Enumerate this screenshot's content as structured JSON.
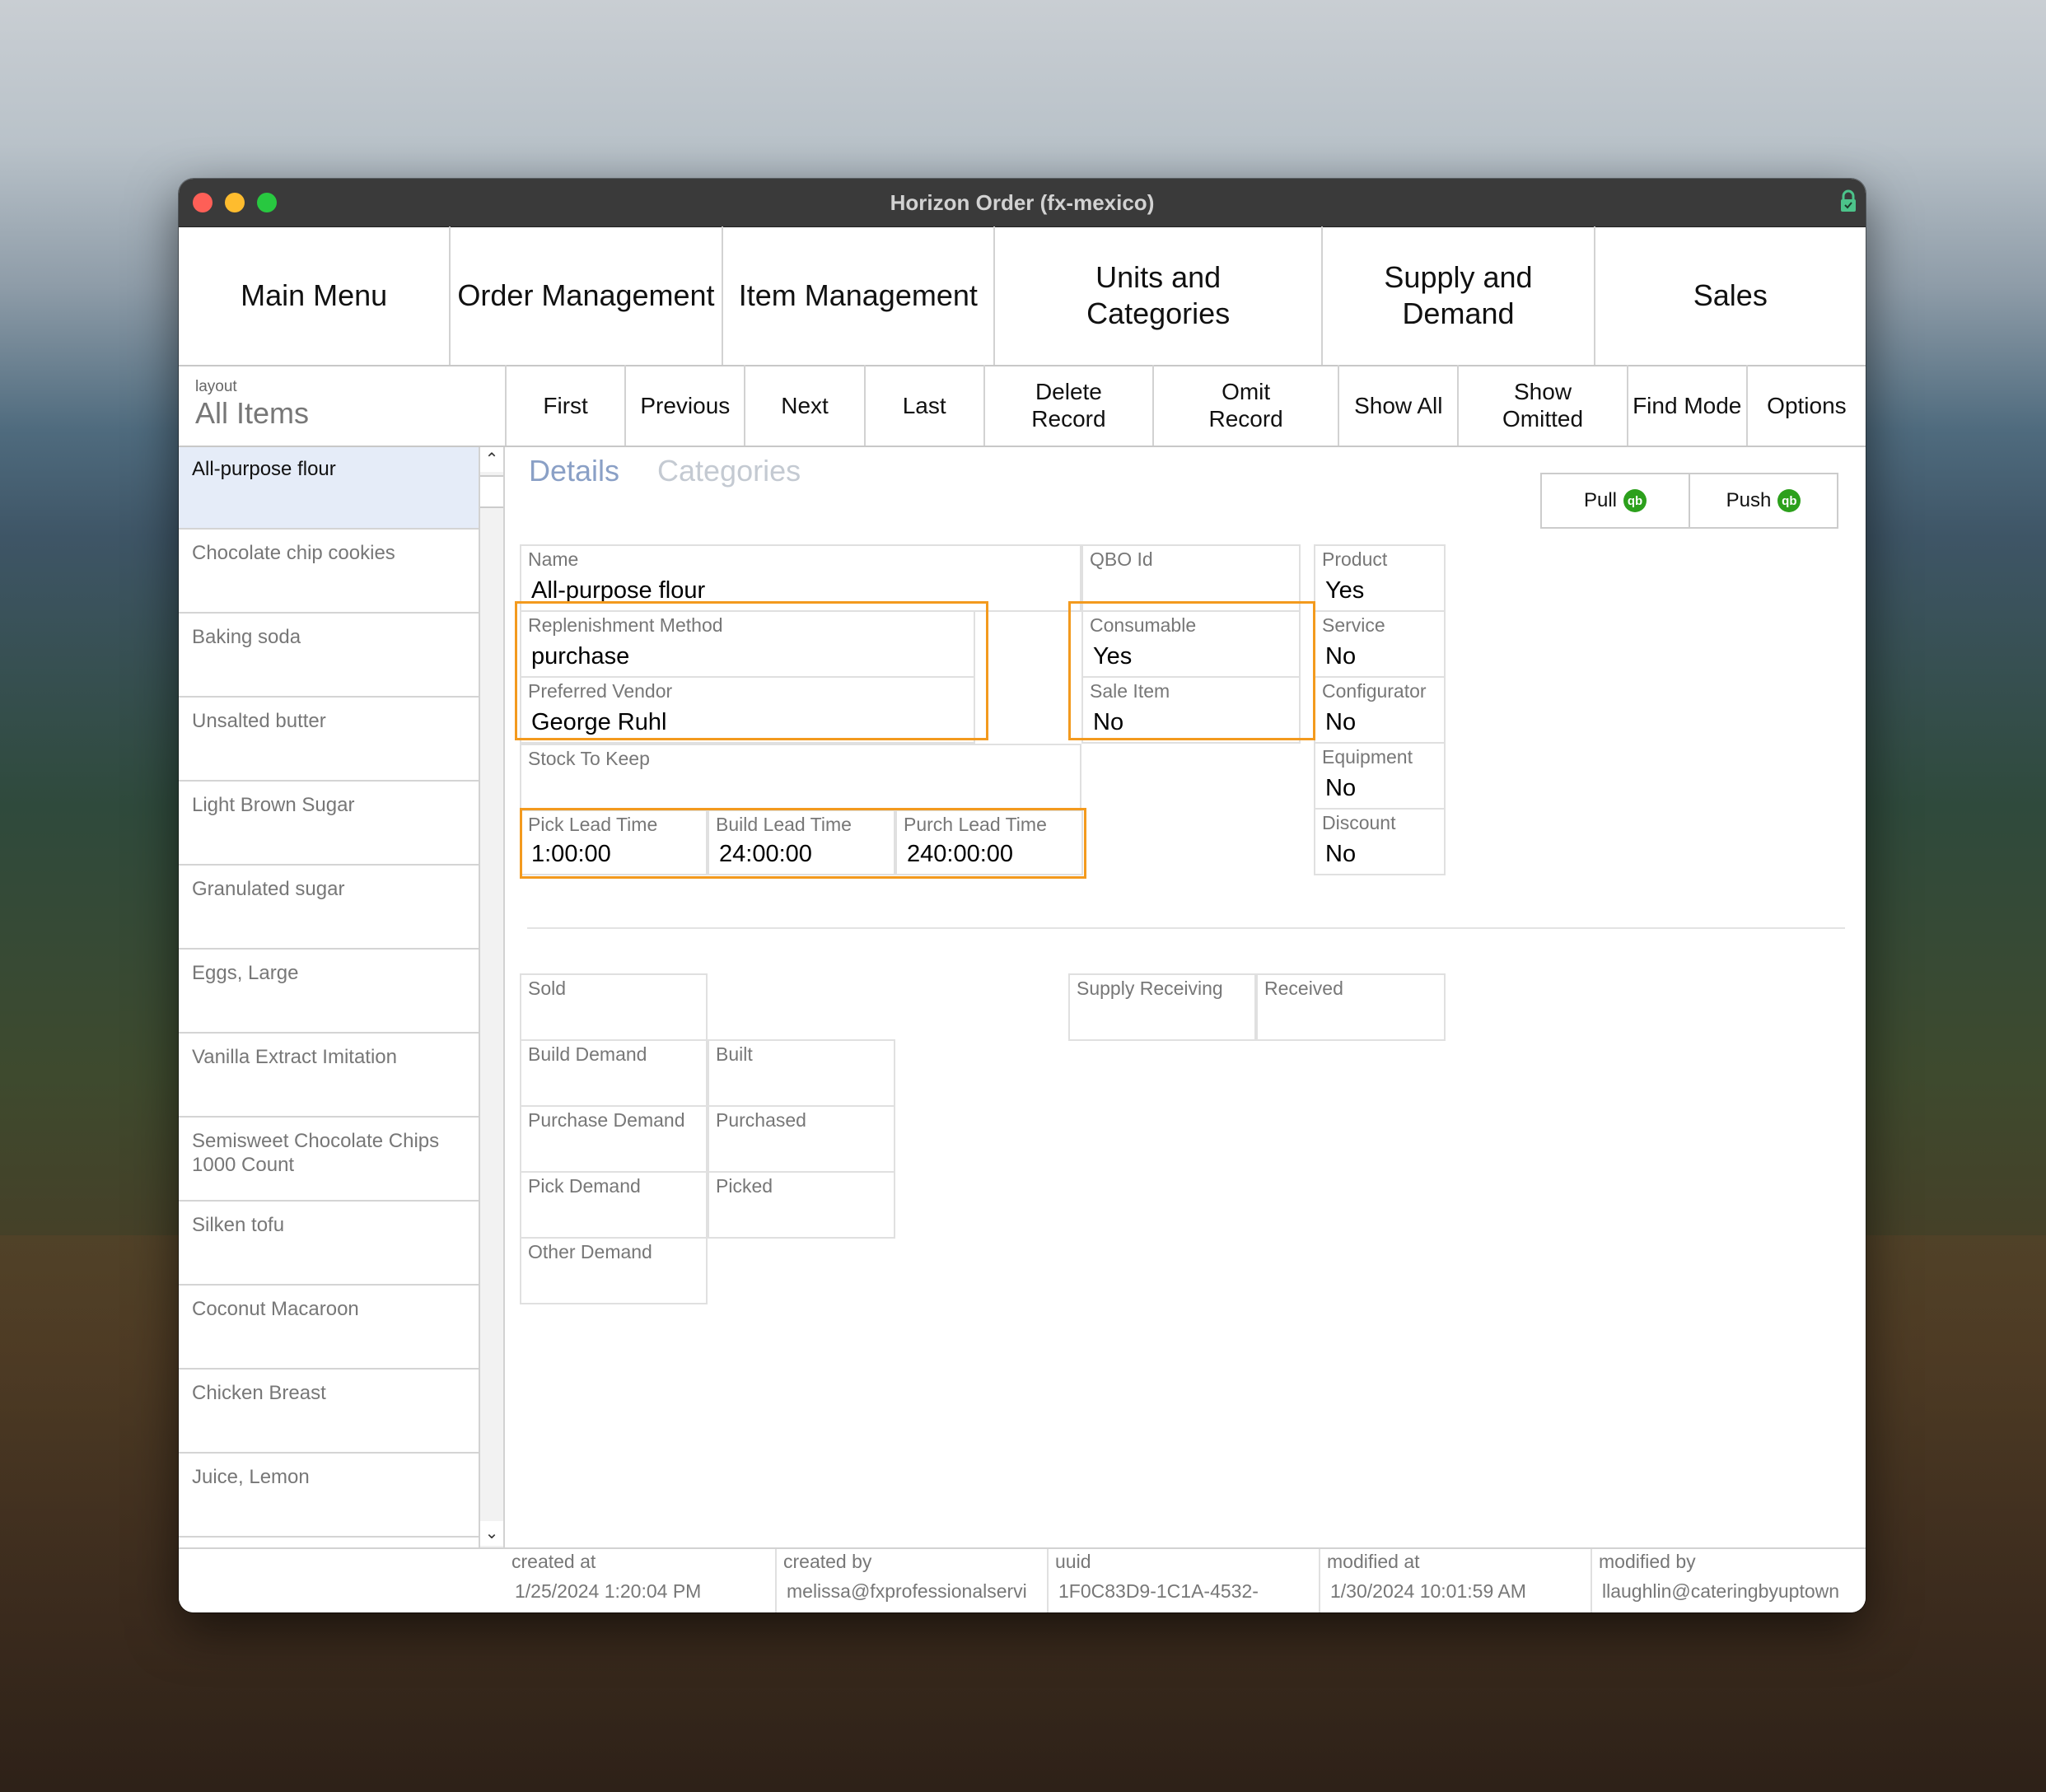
{
  "window": {
    "title": "Horizon Order (fx-mexico)"
  },
  "nav": [
    "Main Menu",
    "Order Management",
    "Item Management",
    "Units and Categories",
    "Supply and Demand",
    "Sales"
  ],
  "layout": {
    "caption": "layout",
    "value": "All Items"
  },
  "toolbar": [
    "First",
    "Previous",
    "Next",
    "Last",
    "Delete Record",
    "Omit Record",
    "Show All",
    "Show Omitted",
    "Find Mode",
    "Options"
  ],
  "sidebar": {
    "selected_index": 0,
    "items": [
      "All-purpose flour",
      "Chocolate chip cookies",
      "Baking soda",
      "Unsalted butter",
      "Light Brown Sugar",
      "Granulated sugar",
      "Eggs, Large",
      "Vanilla Extract Imitation",
      "Semisweet Chocolate Chips 1000 Count",
      "Silken tofu",
      "Coconut Macaroon",
      "Chicken Breast",
      "Juice, Lemon"
    ]
  },
  "tabs": {
    "active": "Details",
    "inactive": "Categories"
  },
  "qb": {
    "pull_label": "Pull",
    "push_label": "Push",
    "icon_text": "qb"
  },
  "fields": {
    "name": {
      "label": "Name",
      "value": "All-purpose flour"
    },
    "qbo_id": {
      "label": "QBO Id",
      "value": ""
    },
    "replenishment_method": {
      "label": "Replenishment Method",
      "value": "purchase"
    },
    "preferred_vendor": {
      "label": "Preferred Vendor",
      "value": "George Ruhl"
    },
    "consumable": {
      "label": "Consumable",
      "value": "Yes"
    },
    "sale_item": {
      "label": "Sale Item",
      "value": "No"
    },
    "stock_to_keep": {
      "label": "Stock To Keep",
      "value": ""
    },
    "pick_lead_time": {
      "label": "Pick Lead Time",
      "value": "1:00:00"
    },
    "build_lead_time": {
      "label": "Build Lead Time",
      "value": "24:00:00"
    },
    "purch_lead_time": {
      "label": "Purch Lead Time",
      "value": "240:00:00"
    },
    "product": {
      "label": "Product",
      "value": "Yes"
    },
    "service": {
      "label": "Service",
      "value": "No"
    },
    "configurator": {
      "label": "Configurator",
      "value": "No"
    },
    "equipment": {
      "label": "Equipment",
      "value": "No"
    },
    "discount": {
      "label": "Discount",
      "value": "No"
    }
  },
  "demand": {
    "sold": "Sold",
    "build_demand": "Build Demand",
    "built": "Built",
    "purchase_demand": "Purchase Demand",
    "purchased": "Purchased",
    "pick_demand": "Pick Demand",
    "picked": "Picked",
    "other_demand": "Other Demand",
    "supply_receiving": "Supply Receiving",
    "received": "Received"
  },
  "footer": {
    "created_at": {
      "label": "created at",
      "value": "1/25/2024 1:20:04 PM"
    },
    "created_by": {
      "label": "created by",
      "value": "melissa@fxprofessionalservi"
    },
    "uuid": {
      "label": "uuid",
      "value": "1F0C83D9-1C1A-4532-"
    },
    "modified_at": {
      "label": "modified at",
      "value": "1/30/2024 10:01:59 AM"
    },
    "modified_by": {
      "label": "modified by",
      "value": "llaughlin@cateringbyuptown"
    }
  },
  "colors": {
    "highlight": "#f39a1e",
    "selected_row": "#e5ecf8",
    "tab_active": "#8aa0c6",
    "tab_inactive": "#c4cad2",
    "quickbooks": "#2ca01c"
  }
}
